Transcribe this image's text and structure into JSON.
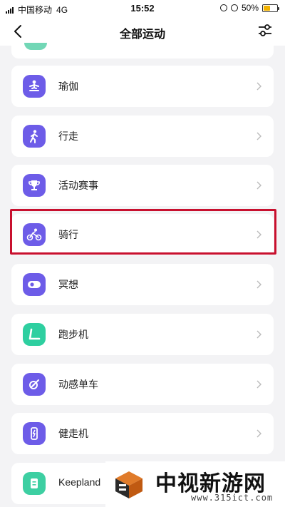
{
  "status_bar": {
    "carrier": "中国移动",
    "network": "4G",
    "time": "15:52",
    "battery": "50%",
    "battery_level": 0.5,
    "battery_color": "#f2b200"
  },
  "nav": {
    "title": "全部运动",
    "back_icon": "chevron-left-icon",
    "filter_icon": "sliders-icon"
  },
  "items": [
    {
      "label": "瑜伽",
      "icon": "yoga-icon",
      "color": "#6d5ce8"
    },
    {
      "label": "行走",
      "icon": "walk-icon",
      "color": "#6d5ce8"
    },
    {
      "label": "活动赛事",
      "icon": "trophy-icon",
      "color": "#6d5ce8"
    },
    {
      "label": "骑行",
      "icon": "cycling-icon",
      "color": "#6d5ce8",
      "highlighted": true
    },
    {
      "label": "冥想",
      "icon": "meditation-icon",
      "color": "#6d5ce8"
    },
    {
      "label": "跑步机",
      "icon": "treadmill-icon",
      "color": "#2ecfa0"
    },
    {
      "label": "动感单车",
      "icon": "spin-bike-icon",
      "color": "#6d5ce8"
    },
    {
      "label": "健走机",
      "icon": "walking-machine-icon",
      "color": "#6d5ce8"
    },
    {
      "label": "Keepland",
      "icon": "keepland-icon",
      "color": "#3dcfa2"
    }
  ],
  "watermark": {
    "title": "中视新游网",
    "url": "www.315ict.com"
  },
  "colors": {
    "highlight": "#c8102e"
  }
}
